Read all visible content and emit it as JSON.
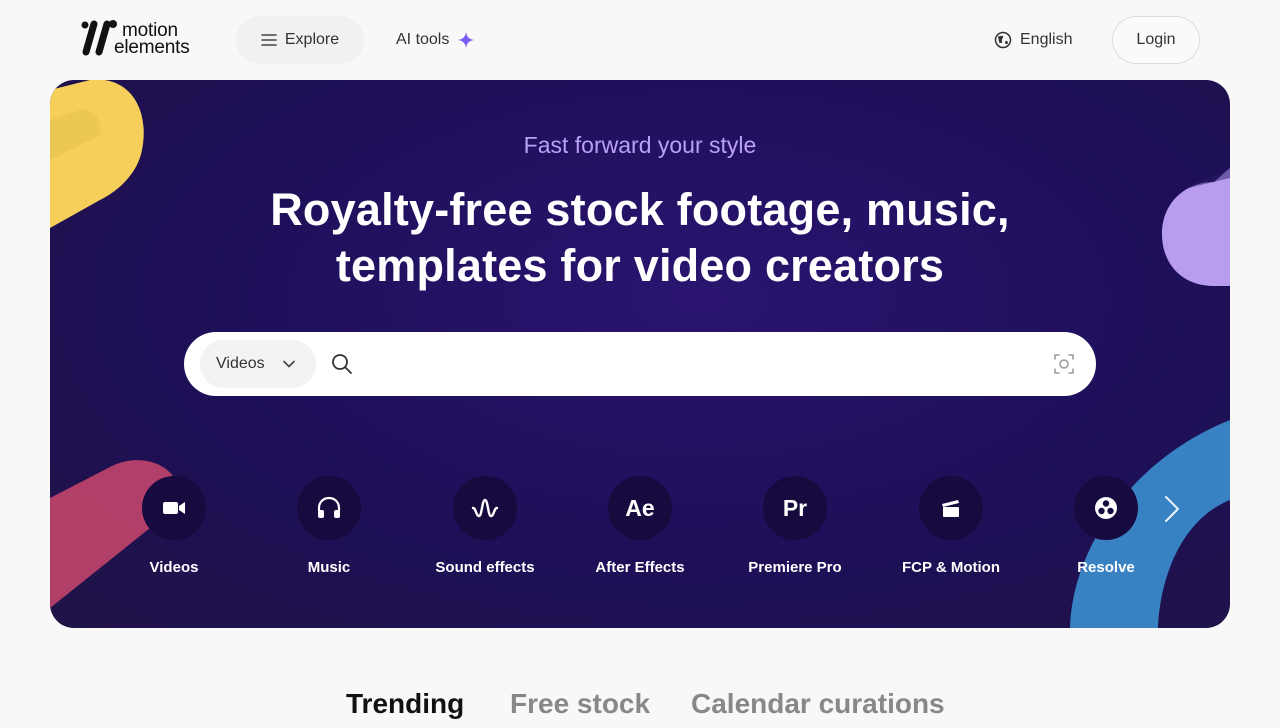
{
  "header": {
    "logo_line1": "motion",
    "logo_line2": "elements",
    "explore_label": "Explore",
    "ai_tools_label": "AI tools",
    "language_label": "English",
    "login_label": "Login"
  },
  "hero": {
    "tagline": "Fast forward your style",
    "headline_line1": "Royalty-free stock footage, music,",
    "headline_line2": "templates for video creators",
    "search": {
      "type_selected": "Videos",
      "placeholder": "",
      "value": ""
    },
    "categories": [
      {
        "label": "Videos",
        "icon": "video-camera-icon"
      },
      {
        "label": "Music",
        "icon": "headphones-icon"
      },
      {
        "label": "Sound effects",
        "icon": "soundwave-icon"
      },
      {
        "label": "After Effects",
        "icon": "after-effects-icon",
        "glyph": "Ae"
      },
      {
        "label": "Premiere Pro",
        "icon": "premiere-pro-icon",
        "glyph": "Pr"
      },
      {
        "label": "FCP & Motion",
        "icon": "clapperboard-icon"
      },
      {
        "label": "Resolve",
        "icon": "resolve-icon"
      }
    ]
  },
  "tabs": [
    {
      "label": "Trending",
      "active": true
    },
    {
      "label": "Free stock",
      "active": false
    },
    {
      "label": "Calendar curations",
      "active": false
    }
  ],
  "colors": {
    "hero_bg": "#1e0f58",
    "tagline": "#b9a1f5",
    "accent_sparkle": "#7b5cf0",
    "yellow_deco": "#f5cf5a",
    "lavender_deco": "#b89cf0",
    "blue_deco": "#3b8fcf",
    "pink_deco": "#c1456c"
  }
}
